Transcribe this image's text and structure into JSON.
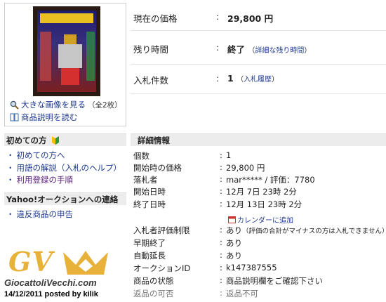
{
  "left": {
    "image_link": "大きな画像を見る",
    "image_count": "（全2枚）",
    "desc_link": "商品説明を読む",
    "beginner_title": "初めての方",
    "beginner_items": [
      "初めての方へ",
      "用語の解説（入札のヘルプ）",
      "利用登録の手順"
    ],
    "contact_title": "Yahoo!オークションへの連絡",
    "contact_items": [
      "違反商品の申告"
    ]
  },
  "summary": {
    "price_label": "現在の価格",
    "price_value": "29,800 円",
    "remaining_label": "残り時間",
    "remaining_value": "終了",
    "remaining_link": "詳細な残り時間",
    "bids_label": "入札件数",
    "bids_value": "1",
    "bids_link": "入札履歴"
  },
  "detail": {
    "title": "詳細情報",
    "rows": [
      {
        "k": "個数",
        "v": "1"
      },
      {
        "k": "開始時の価格",
        "v": "29,800 円"
      },
      {
        "k": "落札者",
        "v": "mar***** / 評価：7780"
      },
      {
        "k": "開始日時",
        "v": "12月 7日 23時 2分"
      },
      {
        "k": "終了日時",
        "v": "12月 13日 23時 2分"
      },
      {
        "k": "入札者評価制限",
        "v": "あり",
        "note": "（評価の合計がマイナスの方は入札できません）"
      },
      {
        "k": "早期終了",
        "v": "あり"
      },
      {
        "k": "自動延長",
        "v": "あり"
      },
      {
        "k": "オークションID",
        "v": "k147387555"
      },
      {
        "k": "商品の状態",
        "v": "商品説明欄をご確認下さい"
      },
      {
        "k": "返品の可否",
        "v": "返品不可"
      }
    ],
    "calendar_link": "カレンダーに追加"
  },
  "watermark": {
    "logo": "GV",
    "site": "GiocattoliVecchi.com",
    "posted": "14/12/2011 posted by kilik"
  }
}
